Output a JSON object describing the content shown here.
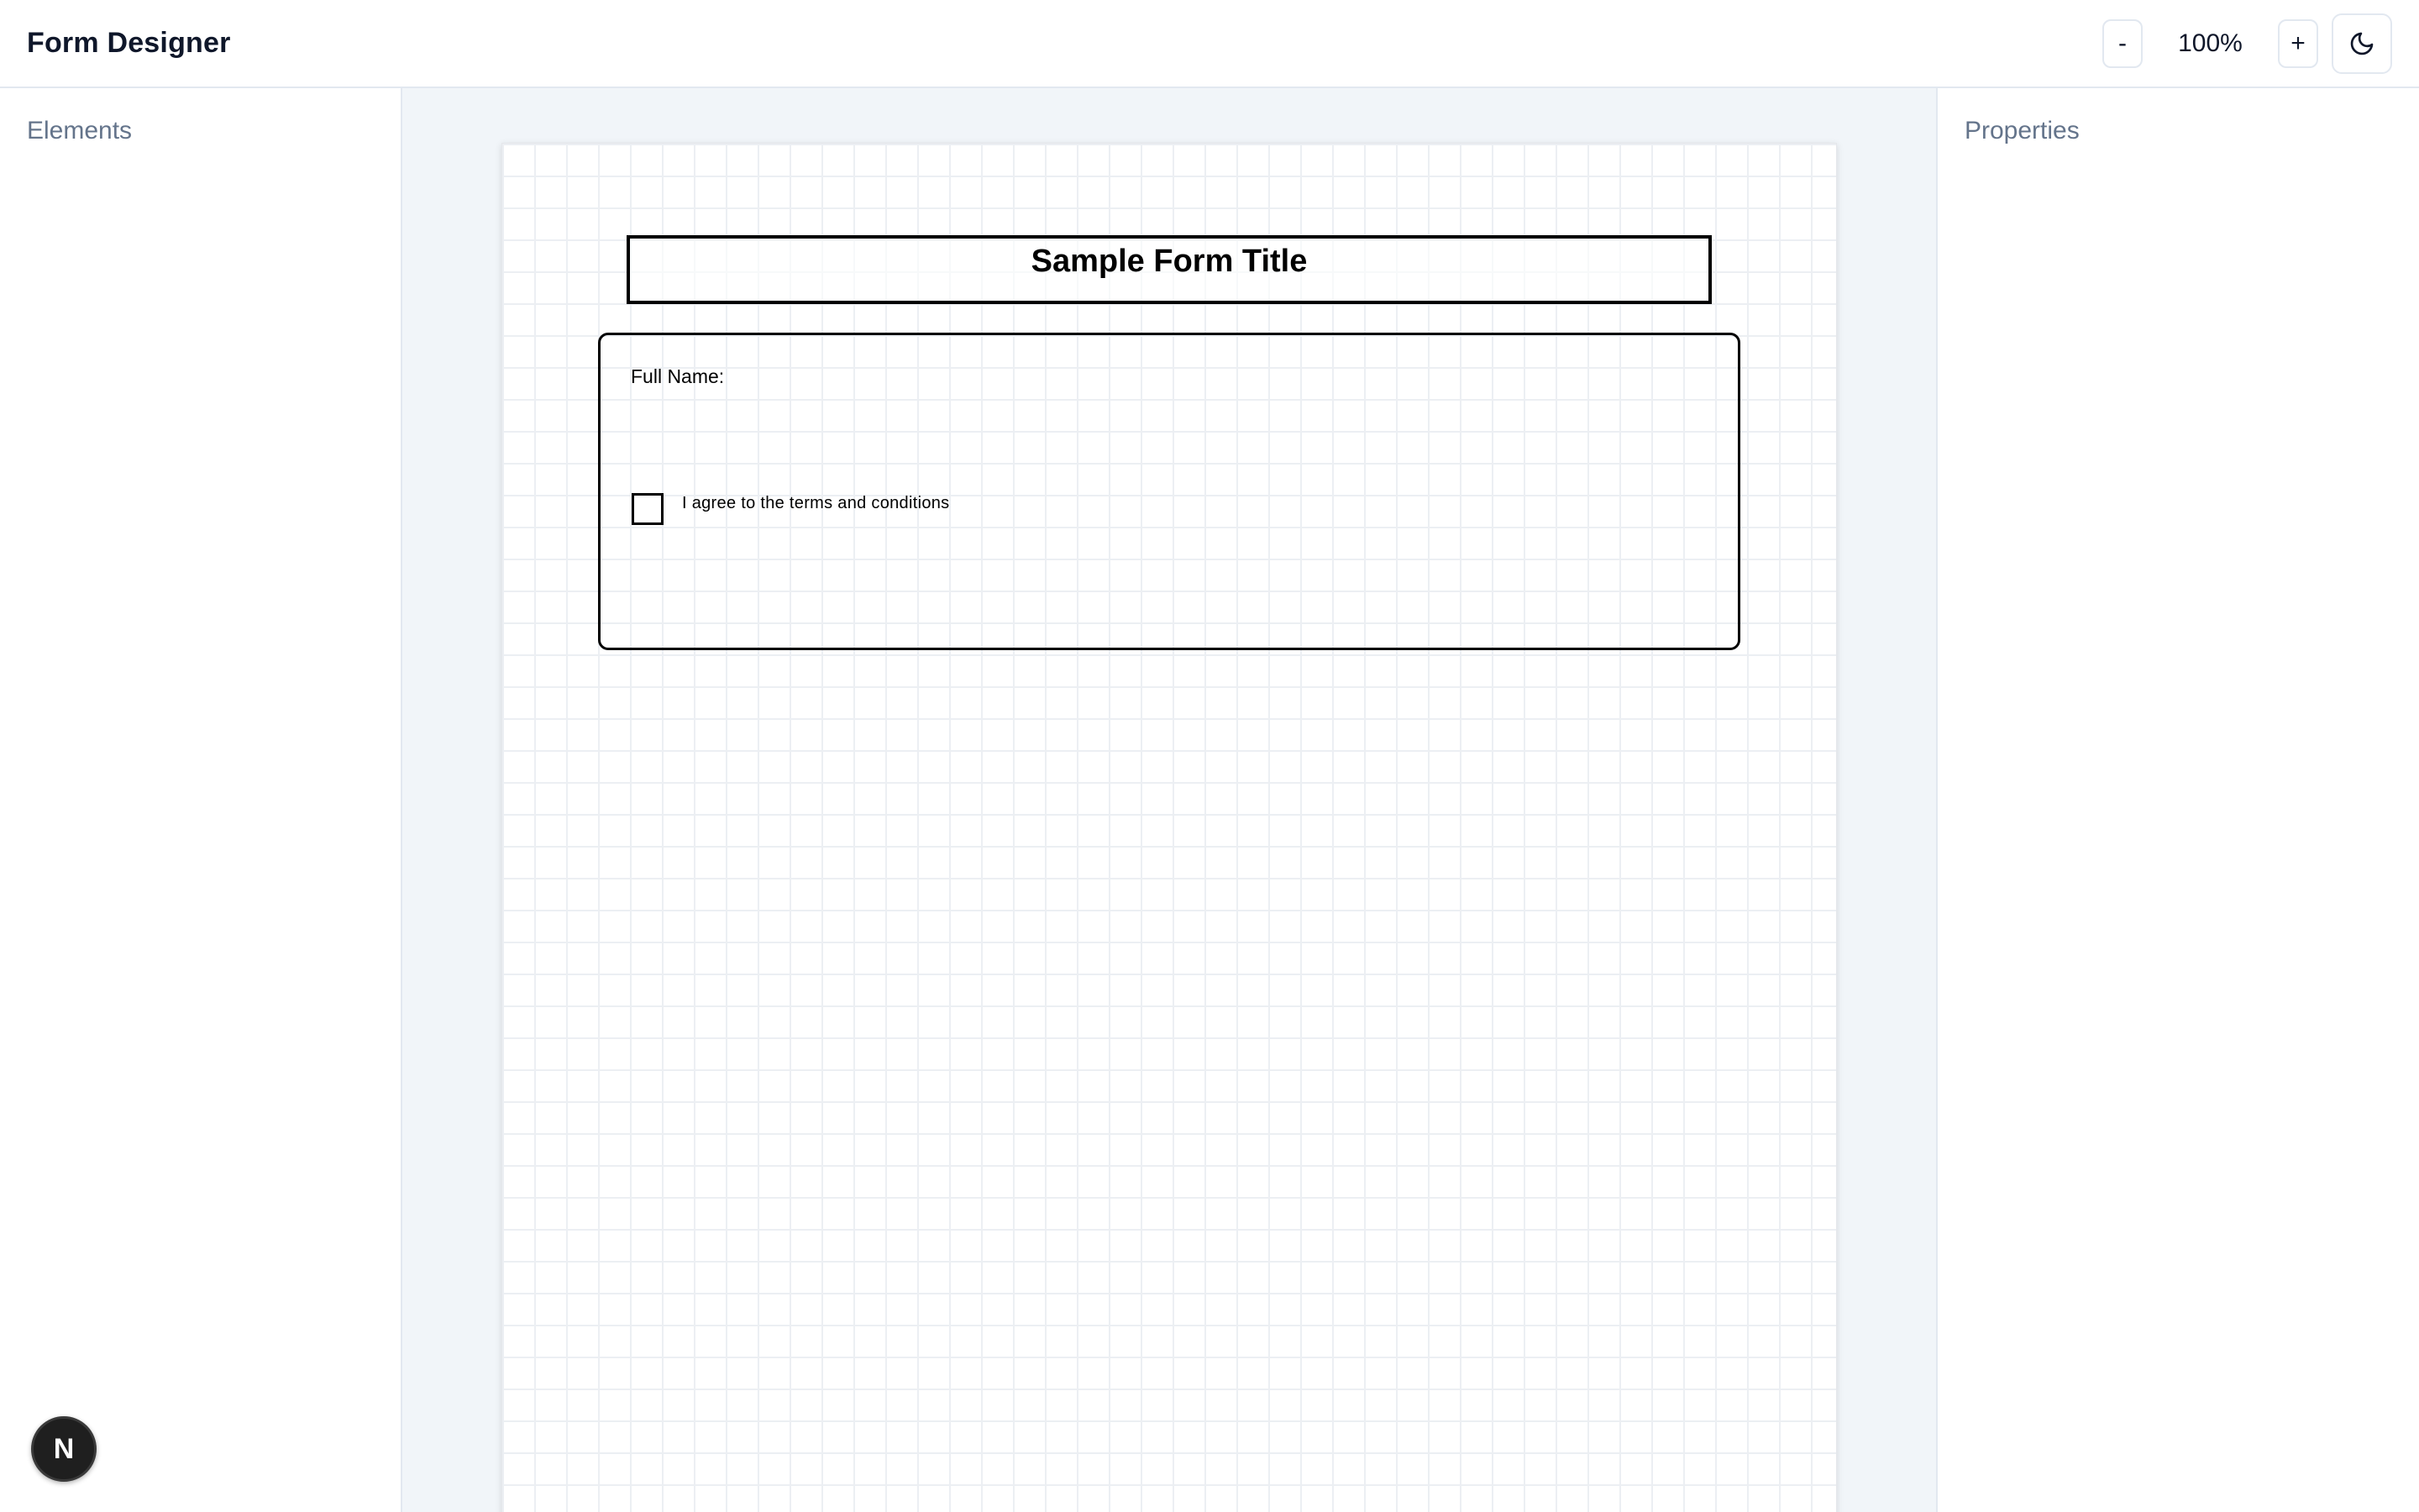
{
  "header": {
    "title": "Form Designer",
    "zoom_out_label": "-",
    "zoom_level": "100%",
    "zoom_in_label": "+",
    "theme_toggle_icon": "moon-icon"
  },
  "sidebar_left": {
    "heading": "Elements"
  },
  "sidebar_right": {
    "heading": "Properties"
  },
  "canvas": {
    "form_title": "Sample Form Title",
    "full_name_label": "Full Name:",
    "checkbox_label": "I agree to the terms and conditions",
    "checkbox_checked": false
  },
  "badge": {
    "letter": "N",
    "icon": "nextjs-logo-icon"
  },
  "colors": {
    "canvas_bg": "#f1f5f9",
    "border": "#e2e8f0",
    "muted_text": "#64748b",
    "badge_bg": "#1f1f1f"
  }
}
